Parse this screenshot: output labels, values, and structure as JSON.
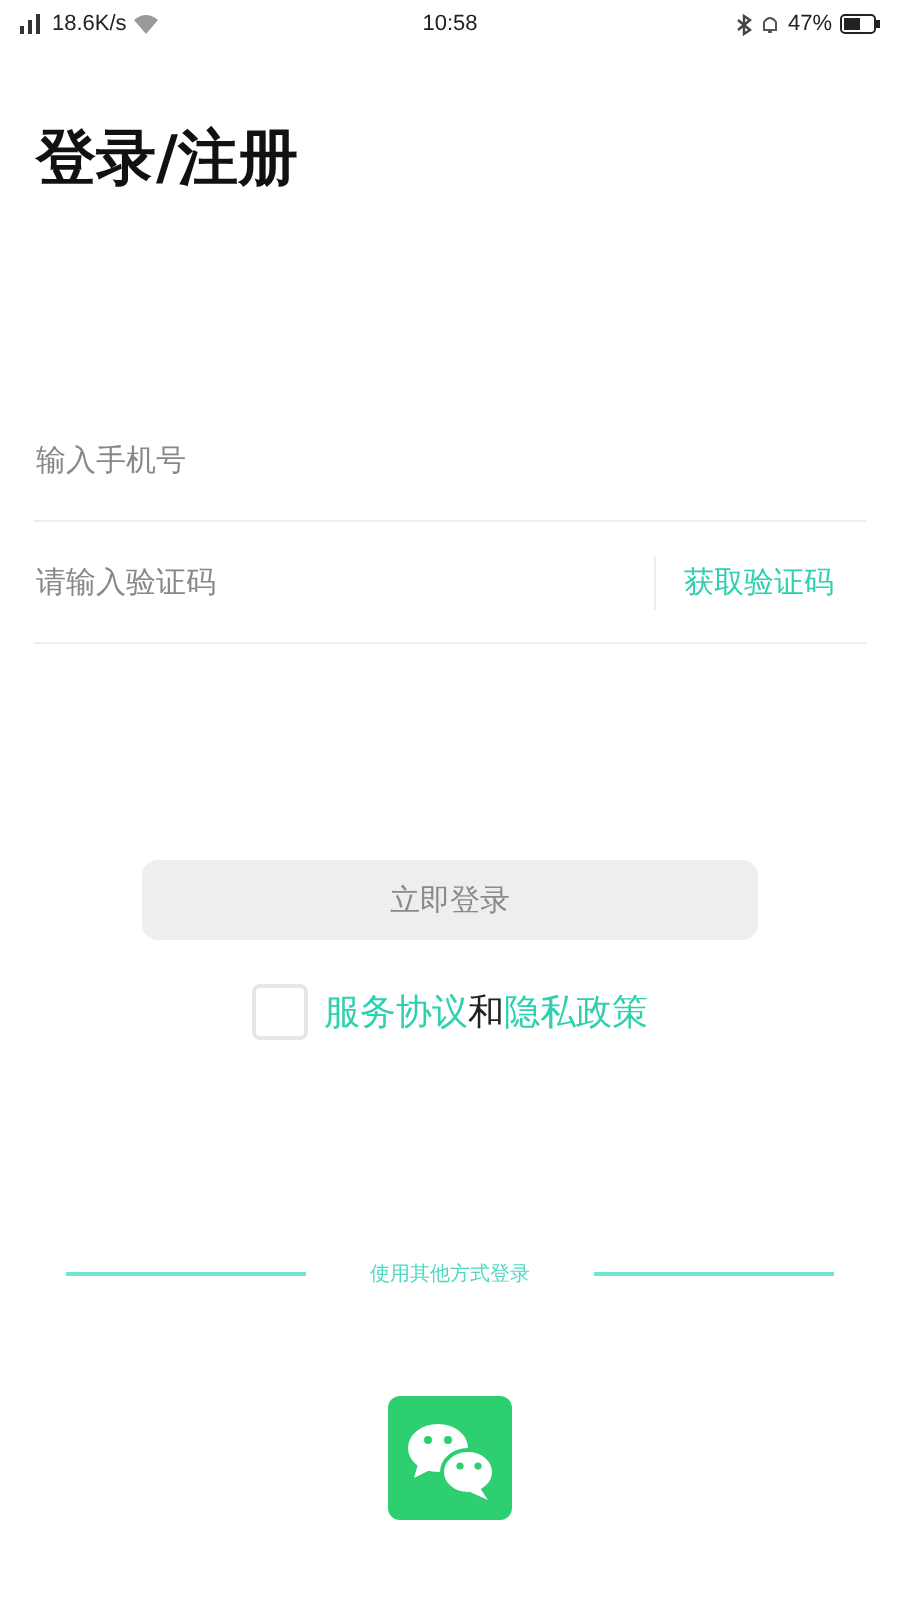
{
  "status_bar": {
    "network_speed": "18.6K/s",
    "time": "10:58",
    "battery": "47%"
  },
  "title": "登录/注册",
  "phone_field": {
    "placeholder": "输入手机号"
  },
  "code_field": {
    "placeholder": "请输入验证码",
    "action": "获取验证码"
  },
  "login_button": {
    "label": "立即登录",
    "disabled": true
  },
  "agreement": {
    "checked": false,
    "parts": [
      {
        "kind": "link",
        "text": "服务协议"
      },
      {
        "kind": "plain",
        "text": "和"
      },
      {
        "kind": "link",
        "text": "隐私政策"
      }
    ]
  },
  "other_login": {
    "label": "使用其他方式登录"
  }
}
